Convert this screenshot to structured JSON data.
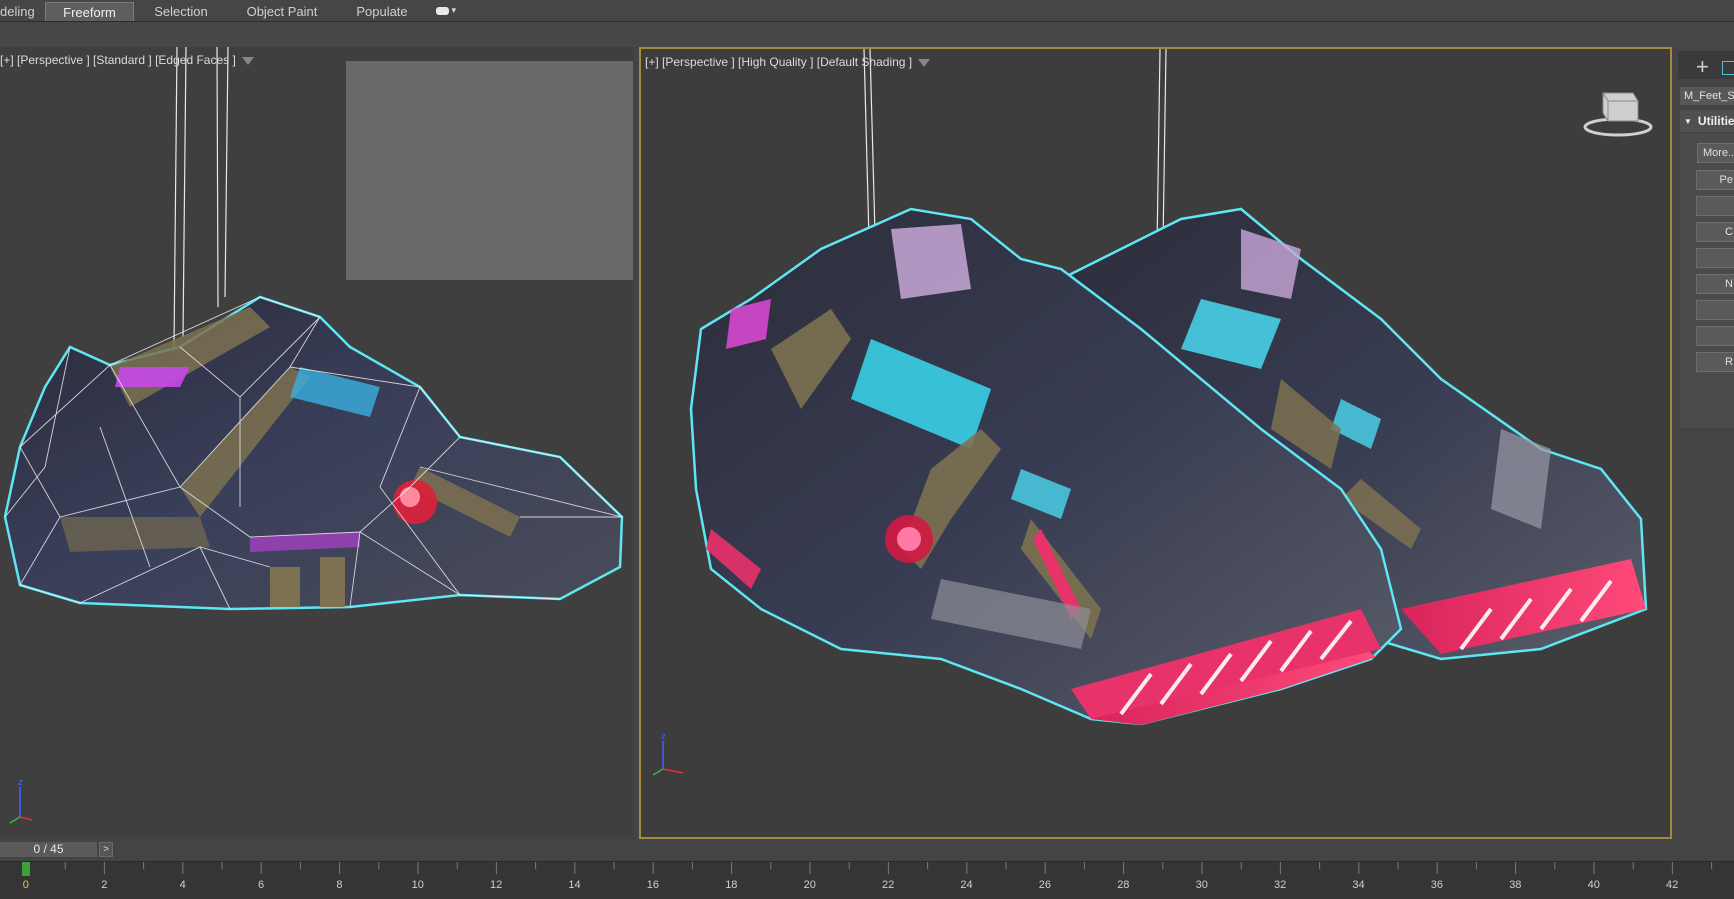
{
  "ribbon": {
    "tabs": [
      {
        "label": "deling",
        "active": false
      },
      {
        "label": "Freeform",
        "active": true
      },
      {
        "label": "Selection",
        "active": false
      },
      {
        "label": "Object Paint",
        "active": false
      },
      {
        "label": "Populate",
        "active": false
      }
    ],
    "dropdown_glyph": "▾"
  },
  "viewports": {
    "left": {
      "label": "[+] [Perspective ] [Standard ] [Edged Faces ]",
      "filter_icon": "funnel-icon"
    },
    "right": {
      "label": "[+] [Perspective ] [High Quality ] [Default Shading ]",
      "filter_icon": "funnel-icon",
      "active_border_color": "#a48a3b"
    },
    "axis": {
      "x": "x",
      "y": "y",
      "z": "z"
    },
    "selection_outline_color": "#5fe6f2"
  },
  "command_panel": {
    "create_icon": "plus-icon",
    "object_name": "M_Feet_S",
    "rollout_title": "Utilitie",
    "buttons": [
      "More...",
      "Pe",
      "",
      "C",
      "",
      "N",
      "",
      "",
      "R"
    ]
  },
  "timeline": {
    "frame_counter": "0 / 45",
    "next_label": ">",
    "current_frame": 0,
    "total_frames": 45,
    "tick_labels": [
      "0",
      "2",
      "4",
      "6",
      "8",
      "10",
      "12",
      "14",
      "16",
      "18",
      "20",
      "22",
      "24",
      "26",
      "28",
      "30",
      "32",
      "34",
      "36",
      "38",
      "40",
      "42"
    ]
  }
}
